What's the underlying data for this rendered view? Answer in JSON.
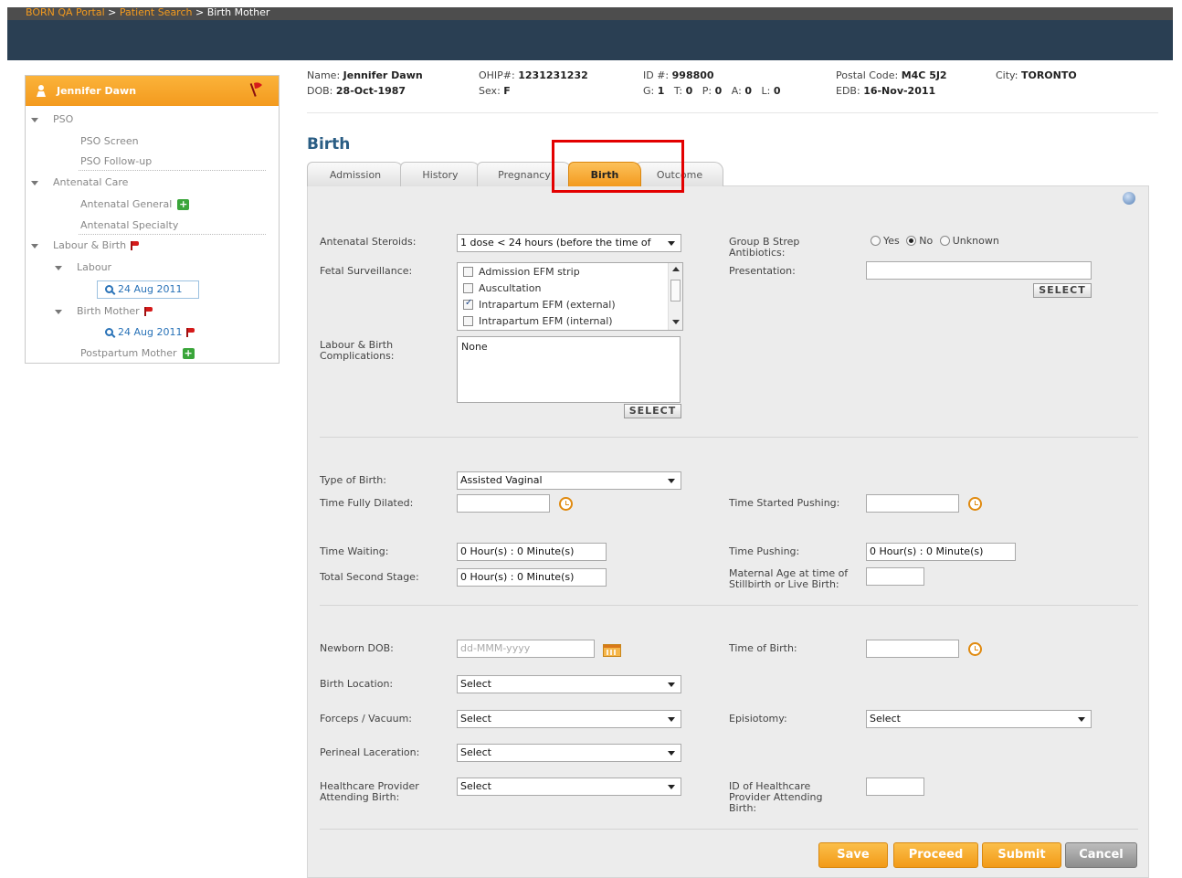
{
  "breadcrumb": {
    "link1": "BORN QA Portal",
    "sep": " > ",
    "link2": "Patient Search",
    "current": "Birth Mother"
  },
  "sidebar": {
    "patient_name": "Jennifer Dawn",
    "pso": "PSO",
    "pso_screen": "PSO Screen",
    "pso_followup": "PSO Follow-up",
    "antenatal_care": "Antenatal Care",
    "antenatal_general": "Antenatal General",
    "antenatal_specialty": "Antenatal Specialty",
    "labour_birth": "Labour & Birth",
    "labour": "Labour",
    "labour_date": "24 Aug 2011",
    "birth_mother": "Birth Mother",
    "birth_mother_date": "24 Aug 2011",
    "postpartum_mother": "Postpartum Mother"
  },
  "patient": {
    "name_label": "Name:",
    "name": "Jennifer Dawn",
    "dob_label": "DOB:",
    "dob": "28-Oct-1987",
    "ohip_label": "OHIP#:",
    "ohip": "1231231232",
    "sex_label": "Sex:",
    "sex": "F",
    "id_label": "ID #:",
    "id": "998800",
    "g_label": "G:",
    "g": "1",
    "t_label": "T:",
    "t": "0",
    "p_label": "P:",
    "p": "0",
    "a_label": "A:",
    "a": "0",
    "l_label": "L:",
    "l": "0",
    "postal_label": "Postal Code:",
    "postal": "M4C 5J2",
    "edb_label": "EDB:",
    "edb": "16-Nov-2011",
    "city_label": "City:",
    "city": "TORONTO"
  },
  "page_title": "Birth",
  "tabs": [
    "Admission",
    "History",
    "Pregnancy",
    "Birth",
    "Outcome"
  ],
  "form": {
    "antenatal_steroids_label": "Antenatal Steroids:",
    "antenatal_steroids_value": "1 dose < 24 hours (before the time of",
    "gbs_label": "Group B Strep Antibiotics:",
    "gbs_yes": "Yes",
    "gbs_no": "No",
    "gbs_unknown": "Unknown",
    "fetal_label": "Fetal Surveillance:",
    "fetal_options": [
      "Admission EFM strip",
      "Auscultation",
      "Intrapartum EFM (external)",
      "Intrapartum EFM (internal)"
    ],
    "presentation_label": "Presentation:",
    "select_btn": "SELECT",
    "complications_label": "Labour & Birth Complications:",
    "complications_value": "None",
    "type_of_birth_label": "Type of Birth:",
    "type_of_birth_value": "Assisted Vaginal",
    "time_fully_dilated_label": "Time Fully Dilated:",
    "time_started_pushing_label": "Time Started Pushing:",
    "time_waiting_label": "Time Waiting:",
    "time_waiting_value": "0 Hour(s) : 0 Minute(s)",
    "time_pushing_label": "Time Pushing:",
    "time_pushing_value": "0 Hour(s) : 0 Minute(s)",
    "total_second_stage_label": "Total Second Stage:",
    "total_second_stage_value": "0 Hour(s) : 0 Minute(s)",
    "maternal_age_label": "Maternal Age at time of Stillbirth or Live Birth:",
    "newborn_dob_label": "Newborn DOB:",
    "newborn_dob_placeholder": "dd-MMM-yyyy",
    "time_of_birth_label": "Time of Birth:",
    "birth_location_label": "Birth Location:",
    "forceps_label": "Forceps / Vacuum:",
    "episiotomy_label": "Episiotomy:",
    "perineal_label": "Perineal Laceration:",
    "provider_label": "Healthcare Provider Attending Birth:",
    "provider_id_label": "ID of Healthcare Provider Attending Birth:",
    "select_default": "Select"
  },
  "buttons": {
    "save": "Save",
    "proceed": "Proceed",
    "submit": "Submit",
    "cancel": "Cancel"
  }
}
